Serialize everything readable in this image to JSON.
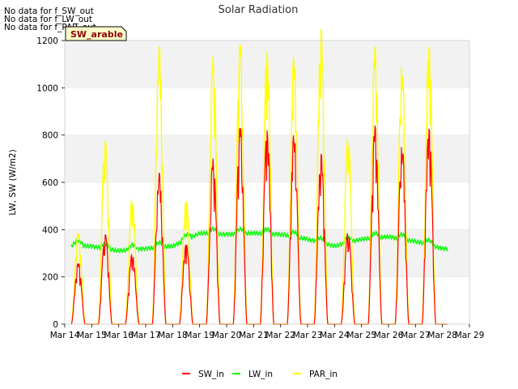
{
  "no_data_messages": [
    "No data for f_SW_out",
    "No data for f_LW_out",
    "No data for f_PAR_out"
  ],
  "site_label": "SW_arable",
  "colors": {
    "SW_in": "#ff0000",
    "LW_in": "#00ff00",
    "PAR_in": "#ffff00",
    "band": "#f2f2f2",
    "grid": "#ffffff"
  },
  "chart_data": {
    "type": "line",
    "title": "Solar Radiation",
    "xlabel": "",
    "ylabel": "LW, SW (W/m2)",
    "ylim": [
      0,
      1200
    ],
    "yticks": [
      0,
      200,
      400,
      600,
      800,
      1000,
      1200
    ],
    "xlim": [
      "Mar 14",
      "Mar 29"
    ],
    "xticks": [
      "Mar 14",
      "Mar 15",
      "Mar 16",
      "Mar 17",
      "Mar 18",
      "Mar 19",
      "Mar 20",
      "Mar 21",
      "Mar 22",
      "Mar 23",
      "Mar 24",
      "Mar 25",
      "Mar 26",
      "Mar 27",
      "Mar 28",
      "Mar 29"
    ],
    "legend_position": "bottom",
    "daily_peaks": {
      "dates": [
        "Mar 14",
        "Mar 15",
        "Mar 16",
        "Mar 17",
        "Mar 18",
        "Mar 19",
        "Mar 20",
        "Mar 21",
        "Mar 22",
        "Mar 23",
        "Mar 24",
        "Mar 25",
        "Mar 26",
        "Mar 27",
        "Mar 28"
      ],
      "SW_in": [
        260,
        380,
        300,
        640,
        340,
        700,
        840,
        820,
        810,
        720,
        390,
        840,
        760,
        830,
        0
      ],
      "PAR_in": [
        370,
        740,
        510,
        1120,
        500,
        1080,
        1140,
        1100,
        1090,
        1190,
        760,
        1120,
        1050,
        1120,
        0
      ],
      "LW_in_level": [
        335,
        330,
        310,
        320,
        330,
        385,
        380,
        385,
        380,
        360,
        330,
        360,
        370,
        350,
        320
      ]
    },
    "series": [
      {
        "name": "SW_in"
      },
      {
        "name": "LW_in"
      },
      {
        "name": "PAR_in"
      }
    ]
  }
}
